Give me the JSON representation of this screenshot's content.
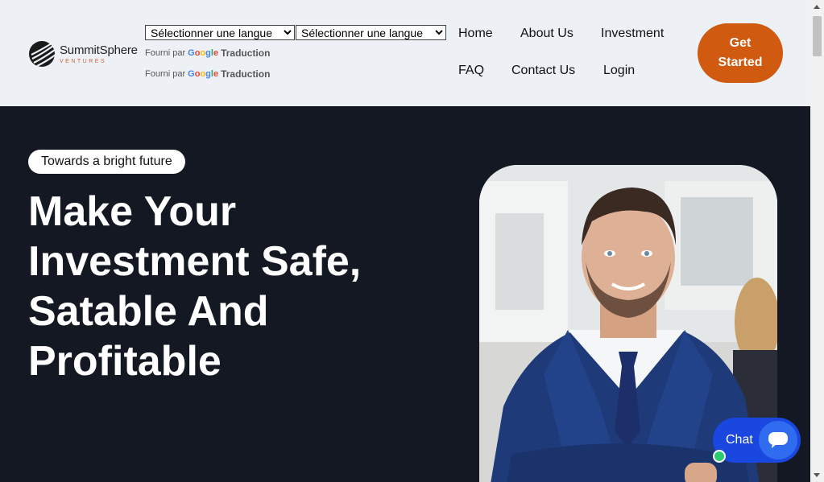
{
  "brand": {
    "name": "SummitSphere",
    "sub": "VENTURES",
    "accent": "#cf5a10"
  },
  "translate": {
    "select_1": "Sélectionner une langue",
    "select_2": "Sélectionner une langue",
    "powered_by": "Fourni par",
    "google": "Google",
    "translation": "Traduction"
  },
  "nav": {
    "home": "Home",
    "about": "About Us",
    "investment": "Investment",
    "faq": "FAQ",
    "contact": "Contact Us",
    "login": "Login",
    "cta_line1": "Get",
    "cta_line2": "Started"
  },
  "hero": {
    "tag": "Towards a bright future",
    "headline": "Make Your Investment Safe, Satable And Profitable",
    "bg_color": "#141822"
  },
  "chat": {
    "label": "Chat",
    "status_color": "#2ecc71"
  }
}
